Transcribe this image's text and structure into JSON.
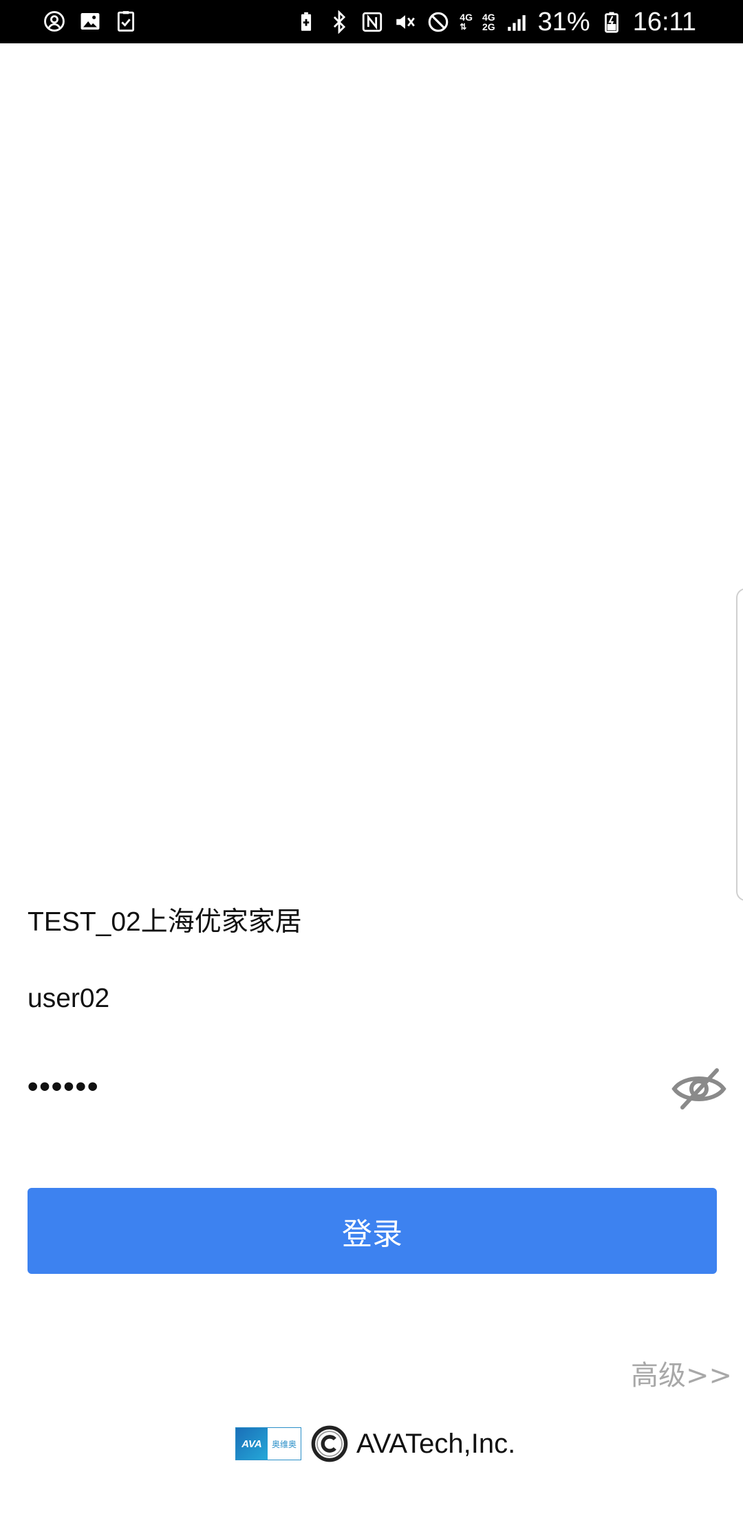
{
  "status_bar": {
    "battery_percent": "31%",
    "time": "16:11",
    "network_top": "4G",
    "network_bottom": "2G"
  },
  "login_form": {
    "company": "TEST_02上海优家家居",
    "username": "user02",
    "password_masked": "••••••",
    "login_button_label": "登录",
    "advanced_link_label": "高级>>"
  },
  "footer": {
    "logo_text": "AVA",
    "logo_subtext": "奥维奥",
    "company_name": "AVATech,Inc."
  },
  "colors": {
    "primary_button": "#3d82f0",
    "advanced_link": "#a8a8a8",
    "status_bar_bg": "#000000"
  }
}
